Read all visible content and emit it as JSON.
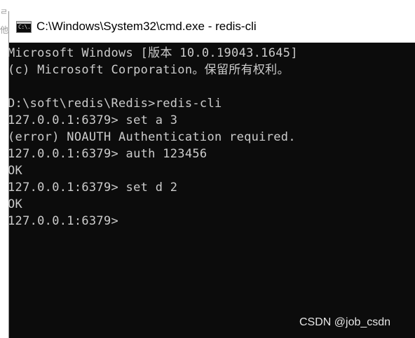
{
  "window": {
    "title": "C:\\Windows\\System32\\cmd.exe - redis-cli",
    "icon": "cmd-icon",
    "icon_glyph": "C:\\."
  },
  "background_fragment": {
    "lines": [
      "ㄹ",
      "他"
    ]
  },
  "console": {
    "lines": [
      "Microsoft Windows [版本 10.0.19043.1645]",
      "(c) Microsoft Corporation。保留所有权利。",
      "",
      "D:\\soft\\redis\\Redis>redis-cli",
      "127.0.0.1:6379> set a 3",
      "(error) NOAUTH Authentication required.",
      "127.0.0.1:6379> auth 123456",
      "OK",
      "127.0.0.1:6379> set d 2",
      "OK",
      "127.0.0.1:6379>"
    ]
  },
  "watermark": "CSDN @job_csdn",
  "colors": {
    "console_bg": "#0c0c0c",
    "console_text": "#cccccc",
    "titlebar_bg": "#ffffff"
  }
}
